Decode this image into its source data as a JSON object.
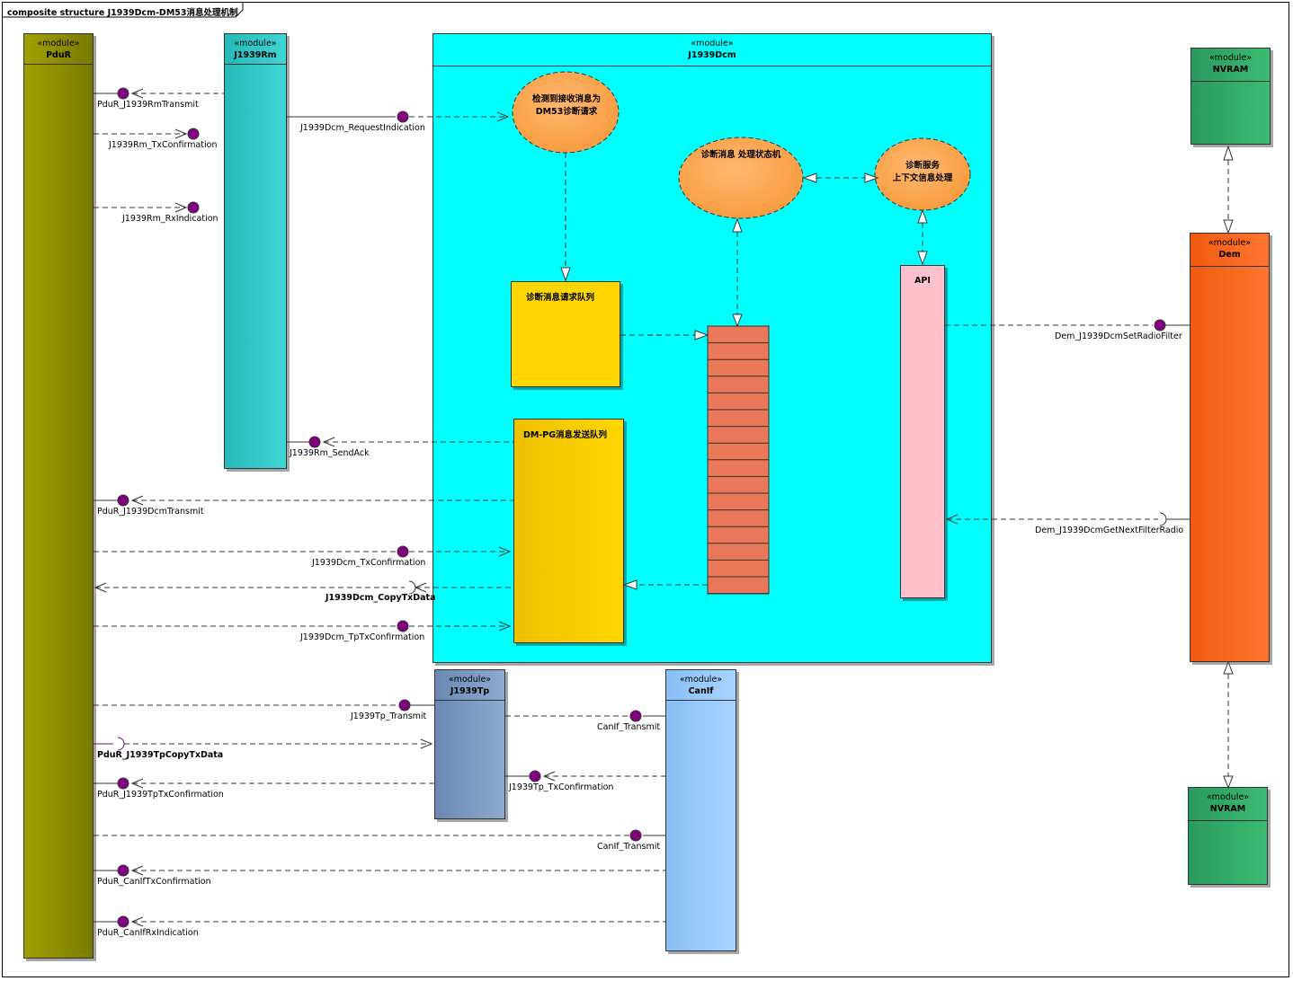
{
  "diagram": {
    "title": "composite structure J1939Dcm-DM53消息处理机制",
    "stereotype": "«module»",
    "modules": {
      "pdur": "PduR",
      "j1939rm": "J1939Rm",
      "j1939dcm": "J1939Dcm",
      "nvram_top": "NVRAM",
      "dem": "Dem",
      "nvram_bottom": "NVRAM",
      "j1939tp": "J1939Tp",
      "canif": "CanIf"
    },
    "parts": {
      "detect_request": "检测到接收消息为\nDM53诊断请求",
      "state_machine": "诊断消息 处理状态机",
      "context_handling": "诊断服务\n上下文信息处理",
      "request_queue": "诊断消息请求队列",
      "send_queue": "DM-PG消息发送队列",
      "api": "API"
    },
    "interfaces": {
      "pdur_j1939rmtransmit": "PduR_J1939RmTransmit",
      "j1939rm_txconfirmation": "J1939Rm_TxConfirmation",
      "j1939rm_rxindication": "J1939Rm_RxIndication",
      "j1939dcm_requestindication": "J1939Dcm_RequestIndication",
      "j1939rm_sendack": "J1939Rm_SendAck",
      "pdur_j1939dcmtransmit": "PduR_J1939DcmTransmit",
      "j1939dcm_txconfirmation": "J1939Dcm_TxConfirmation",
      "j1939dcm_copytxdata": "J1939Dcm_CopyTxData",
      "j1939dcm_tptxconfirmation": "J1939Dcm_TpTxConfirmation",
      "dem_setradiofilter": "Dem_J1939DcmSetRadioFilter",
      "dem_getnextfilterradio": "Dem_J1939DcmGetNextFilterRadio",
      "j1939tp_transmit": "J1939Tp_Transmit",
      "pdur_j1939tpcopytxdata": "PduR_J1939TpCopyTxData",
      "pdur_j1939tptxconfirmation": "PduR_J1939TpTxConfirmation",
      "j1939tp_txconfirmation": "J1939Tp_TxConfirmation",
      "canif_transmit_1": "CanIf_Transmit",
      "canif_transmit_2": "CanIf_Transmit",
      "pdur_caniftxconfirmation": "PduR_CanIfTxConfirmation",
      "pdur_canifrxindication": "PduR_CanIfRxIndication"
    }
  },
  "colors": {
    "pdur": "#8b8b00",
    "j1939rm": "#2ec8c8",
    "j1939dcm": "#00ffff",
    "nvram": "#33b06b",
    "dem": "#ff6622",
    "j1939tp": "#7f9ec6",
    "canif": "#9cccff",
    "ellipse": "#ffa24f",
    "queue": "#ffd700",
    "fifo": "#ea7757",
    "api": "#ffc2cc",
    "port": "#800080"
  }
}
